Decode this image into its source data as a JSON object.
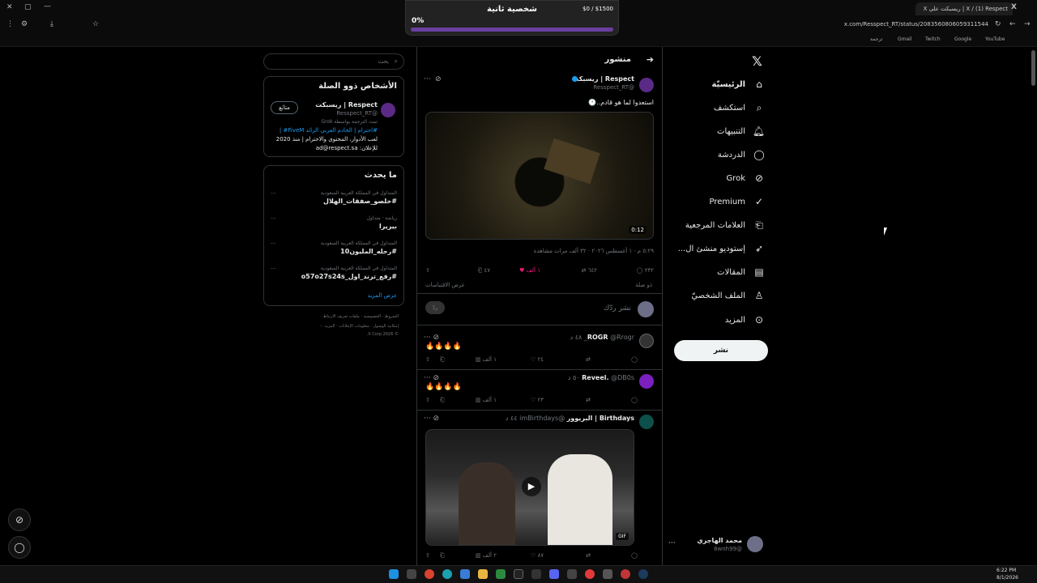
{
  "browser": {
    "tab_title": "X / (1) Respect | ريسبكت على X",
    "url": "x.com/Resspect_RT/status/2083560806059311544",
    "bookmarks": [
      "YouTube",
      "Google",
      "Twitch",
      "Gmail",
      "ترجمة"
    ]
  },
  "overlay": {
    "title": "شخصية ثانية",
    "amount": "$0 / $1500",
    "percent": "0%",
    "progress": 0,
    "bar_color": "#6b3fa0"
  },
  "nav": {
    "items": [
      {
        "label": "الرئيسيّة",
        "icon": "home-icon"
      },
      {
        "label": "استكشف",
        "icon": "search-icon"
      },
      {
        "label": "التنبيهات",
        "icon": "bell-icon"
      },
      {
        "label": "الدردشة",
        "icon": "chat-icon"
      },
      {
        "label": "Grok",
        "icon": "grok-icon"
      },
      {
        "label": "Premium",
        "icon": "premium-icon"
      },
      {
        "label": "العلامات المرجعية",
        "icon": "bookmark-icon"
      },
      {
        "label": "إستوديو منشئ ال...",
        "icon": "rocket-icon"
      },
      {
        "label": "المقالات",
        "icon": "article-icon"
      },
      {
        "label": "الملف الشخصيّ",
        "icon": "person-icon"
      },
      {
        "label": "المزيد",
        "icon": "more-icon"
      }
    ],
    "post_button": "نشر",
    "account_name": "محمد الهاجري",
    "account_handle": "@8wnh99"
  },
  "header": {
    "title": "منشور"
  },
  "tweet": {
    "author": "Respect | ريسبكت",
    "handle": "@Resspect_RT",
    "text": "استعدوا لما هو قادم..🕐",
    "video_duration": "0:12",
    "meta": "٥:٢٩ م · ١ أغسطس ٢٠٢٦ · ٣٢ ألف",
    "meta_suffix": "مرات مشاهدة",
    "replies": "٢٣٢",
    "retweets": "٦٤٢",
    "likes": "١ ألف",
    "bookmarks": "٤٧",
    "related": "ذو صلة",
    "quotes": "عرض الاقتباسات",
    "reply_placeholder": "نشر ردّك",
    "reply_button": "ردّ"
  },
  "replies": [
    {
      "name": "ROGR",
      "handle": "@Rrogr_",
      "time": "٤٨ د",
      "text": "🔥🔥🔥🔥",
      "views": "١ ألف",
      "likes": "٢٤"
    },
    {
      "name": "Reveel.",
      "handle": "@DB0s",
      "time": "٥٠ د",
      "text": "🔥🔥🔥🔥",
      "views": "١ ألف",
      "likes": "٢٣"
    },
    {
      "name": "Birthdays | البريوور",
      "handle": "@imBirthdays",
      "time": "٤٤ د",
      "text": "",
      "views": "٢ ألف",
      "likes": "٨٧",
      "gif": "GIF"
    }
  ],
  "search": {
    "placeholder": "بحث"
  },
  "relevant": {
    "title": "الأشخاص ذوو الصلة",
    "name": "Respect | ريسبكت",
    "handle": "@Resspect_RT",
    "follow": "متابَع",
    "translated_by": "تمت الترجمة بواسطة Grok",
    "bio_line1": "#احترام | الخادم العربي الرائد FiveM# |",
    "bio_line2": "لعب الأدوار، المحتوى والاحترام | منذ 2020",
    "bio_line3": "للإعلان: ad@respect.sa"
  },
  "trends": {
    "title": "ما يحدث",
    "items": [
      {
        "context": "المتداول في المملكة العربية السعودية",
        "name": "#خلصو_صفقات_الهلال"
      },
      {
        "context": "رياضة · متداول",
        "name": "بيريرا"
      },
      {
        "context": "المتداول في المملكة العربية السعودية",
        "name": "#رحله_المليون10"
      },
      {
        "context": "المتداول في المملكة العربية السعودية",
        "name": "#رفع_ترند_اول_o57o27s24s"
      }
    ],
    "show_more": "عرض المزيد"
  },
  "footer": {
    "line1": "الشروط · الخصوصية · ملفات تعريف الارتباط ·",
    "line2": "إمكانية الوصول · معلومات الإعلانات · المزيد ···",
    "line3": "© 2026 X Corp."
  },
  "taskbar": {
    "time": "6:22 PM",
    "date": "8/1/2026"
  }
}
